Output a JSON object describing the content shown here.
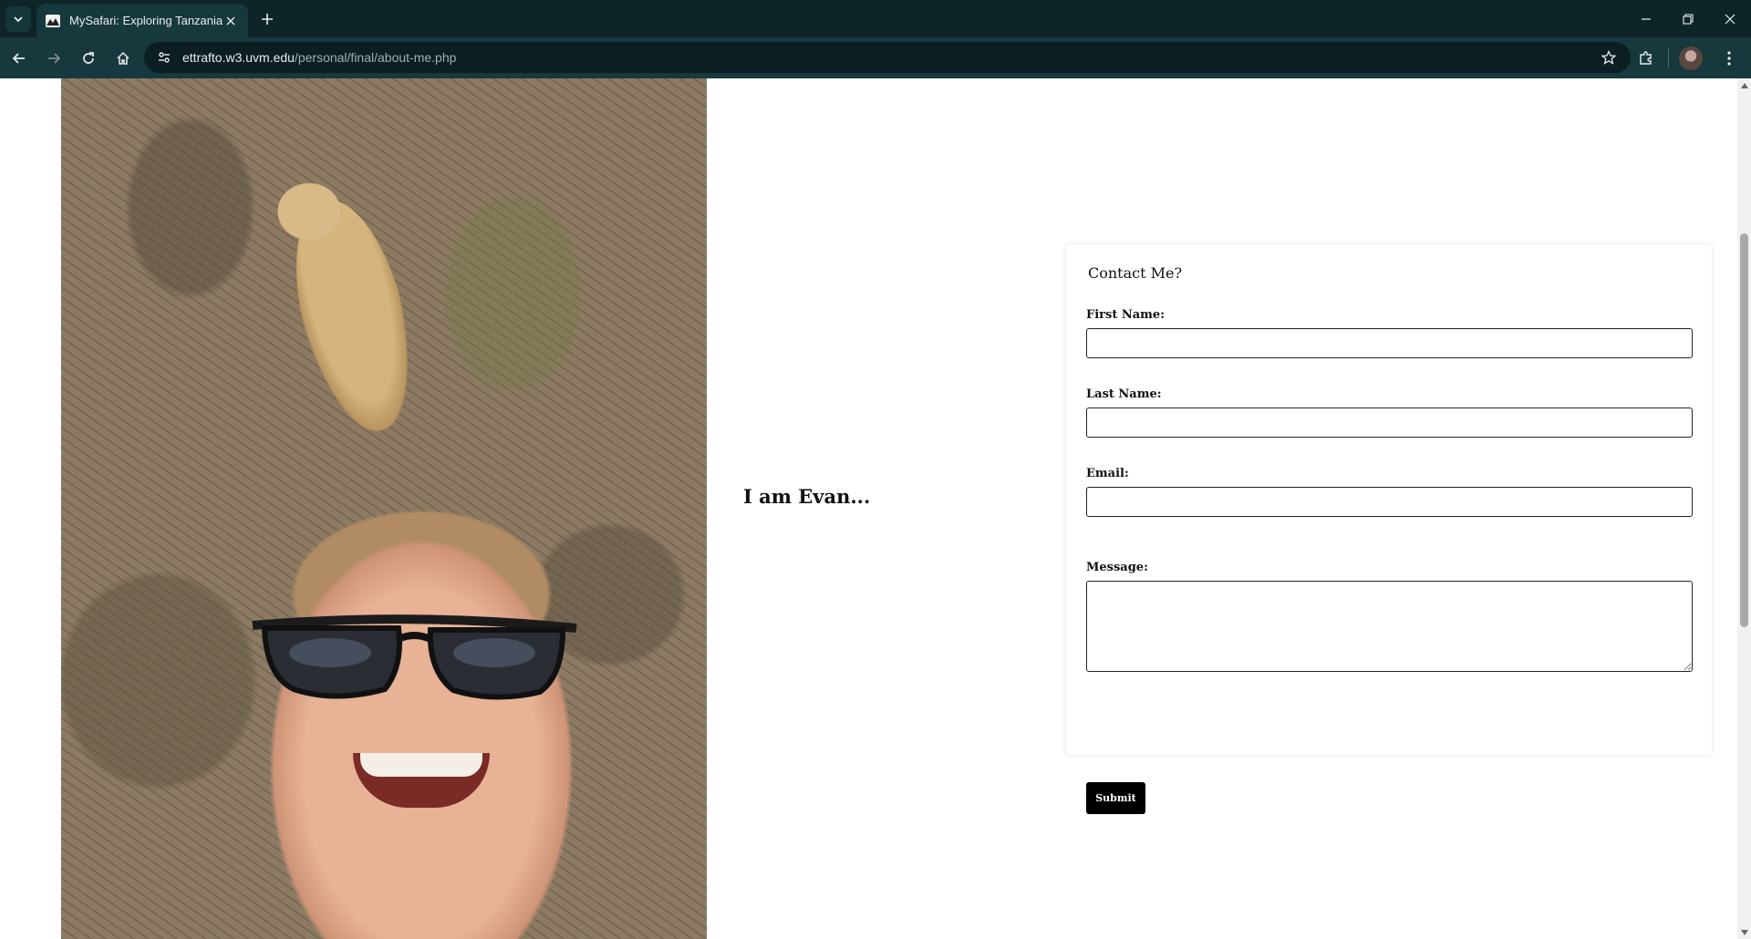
{
  "browser": {
    "tab": {
      "title": "MySafari: Exploring Tanzania"
    },
    "address": {
      "host": "ettrafto.w3.uvm.edu",
      "path": "/personal/final/about-me.php"
    },
    "icons": {
      "tab_search": "chevron-down-icon",
      "tab_close": "close-icon",
      "new_tab": "plus-icon",
      "minimize": "minimize-icon",
      "restore": "restore-icon",
      "close_window": "close-icon",
      "back": "back-arrow-icon",
      "forward": "forward-arrow-icon",
      "reload": "reload-icon",
      "home": "home-icon",
      "site_info": "site-settings-icon",
      "bookmark": "star-icon",
      "extensions": "puzzle-icon",
      "menu": "kebab-menu-icon"
    }
  },
  "page": {
    "photo_alt": "Selfie with a sleeping lioness",
    "heading": "I am Evan...",
    "contact": {
      "title": "Contact Me?",
      "first_name_label": "First Name:",
      "last_name_label": "Last Name:",
      "email_label": "Email:",
      "message_label": "Message:",
      "first_name_value": "",
      "last_name_value": "",
      "email_value": "",
      "message_value": "",
      "submit_label": "Submit"
    }
  },
  "colors": {
    "chrome_dark": "#0e2427",
    "chrome_toolbar": "#17383d",
    "button_black": "#000000"
  }
}
